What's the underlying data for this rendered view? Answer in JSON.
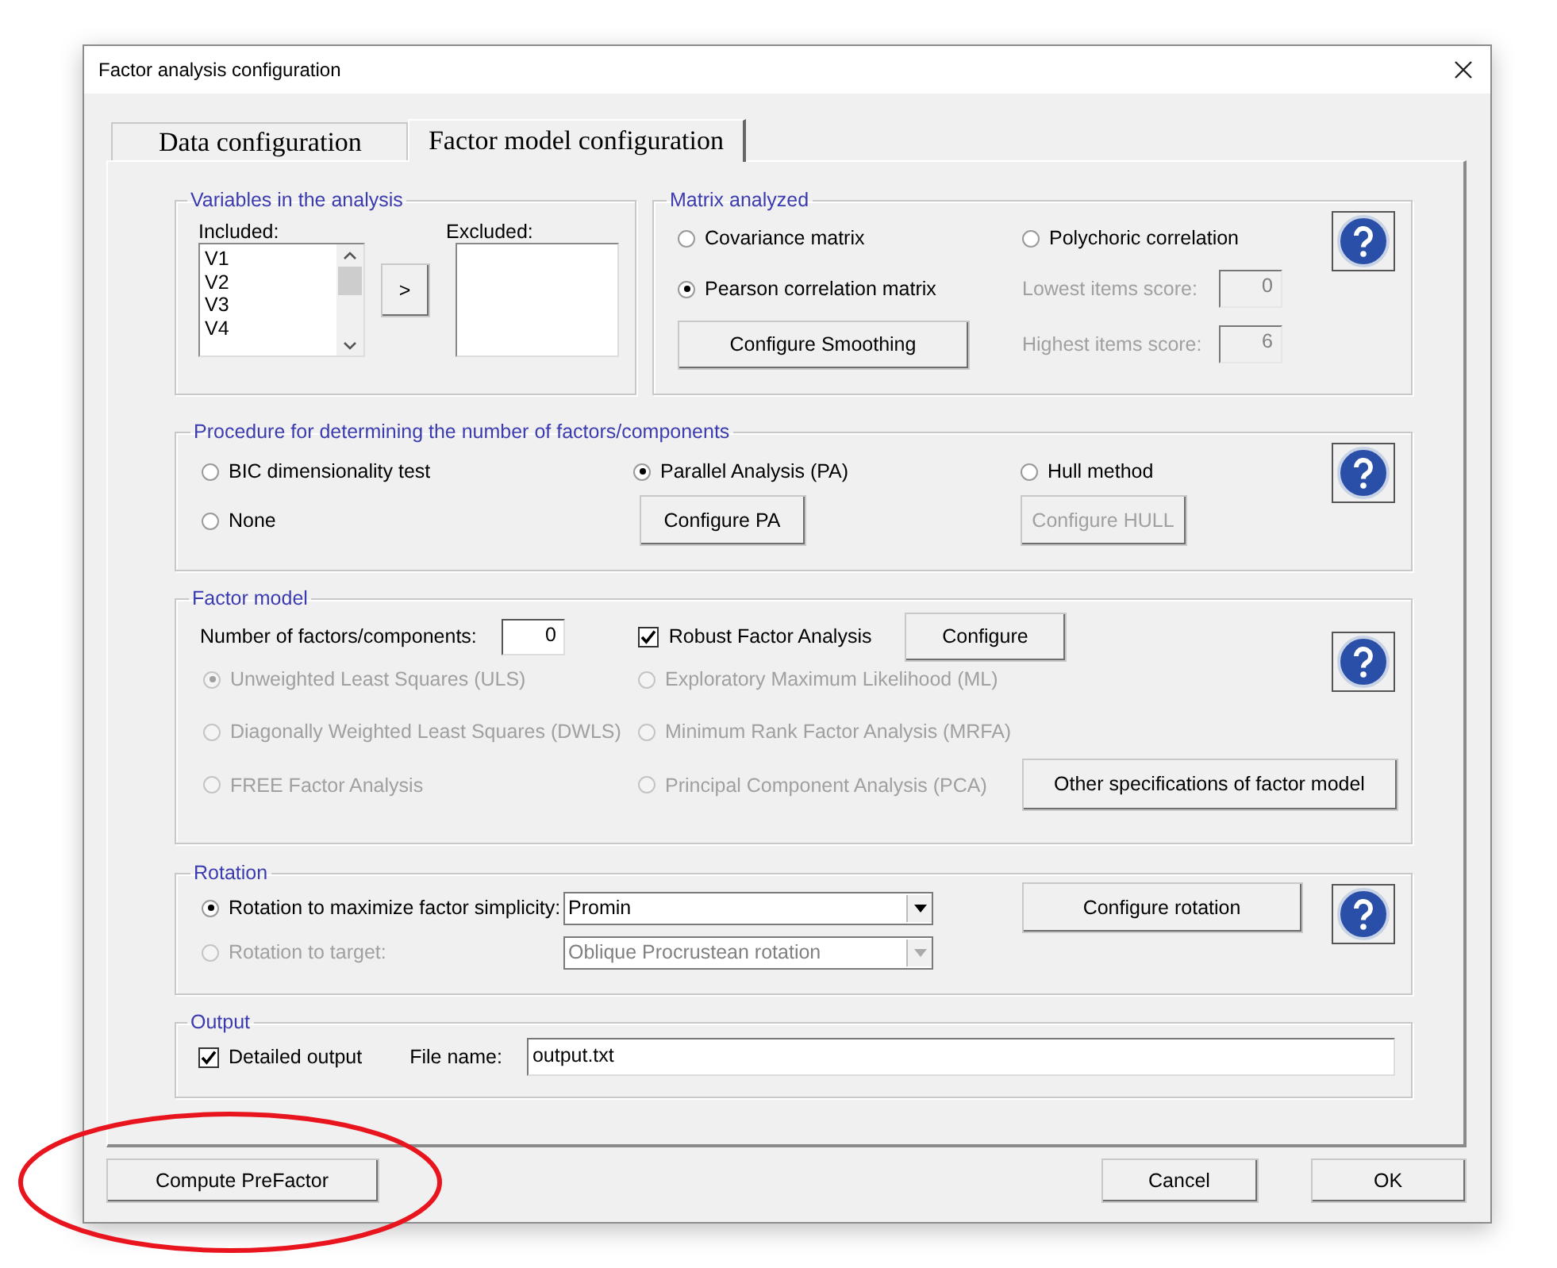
{
  "window": {
    "title": "Factor analysis configuration"
  },
  "tabs": [
    {
      "label": "Data configuration",
      "selected": false
    },
    {
      "label": "Factor model configuration",
      "selected": true
    }
  ],
  "variables": {
    "title": "Variables in the analysis",
    "included_label": "Included:",
    "included": [
      "V1",
      "V2",
      "V3",
      "V4"
    ],
    "move_button": ">",
    "excluded_label": "Excluded:"
  },
  "matrix": {
    "title": "Matrix analyzed",
    "options": [
      {
        "label": "Covariance matrix",
        "selected": false,
        "disabled": false
      },
      {
        "label": "Pearson correlation matrix",
        "selected": true,
        "disabled": false
      },
      {
        "label": "Polychoric correlation",
        "selected": false,
        "disabled": false
      }
    ],
    "smoothing_button": "Configure Smoothing",
    "scores": [
      {
        "label": "Lowest items score:",
        "value": "0",
        "disabled": true
      },
      {
        "label": "Highest items score:",
        "value": "6",
        "disabled": true
      }
    ]
  },
  "procedure": {
    "title": "Procedure for determining the number of factors/components",
    "options": [
      {
        "label": "BIC dimensionality test",
        "selected": false,
        "disabled": false
      },
      {
        "label": "Parallel Analysis (PA)",
        "selected": true,
        "disabled": false
      },
      {
        "label": "Hull method",
        "selected": false,
        "disabled": false
      },
      {
        "label": "None",
        "selected": false,
        "disabled": false
      }
    ],
    "buttons": [
      {
        "label": "Configure PA",
        "disabled": false
      },
      {
        "label": "Configure HULL",
        "disabled": true
      }
    ]
  },
  "factor_model": {
    "title": "Factor model",
    "factors_label": "Number of factors/components:",
    "factors_value": "0",
    "robust": {
      "label": "Robust Factor Analysis",
      "checked": true
    },
    "configure_button": "Configure",
    "methods": [
      {
        "label": "Unweighted Least Squares (ULS)",
        "selected": true,
        "disabled": true
      },
      {
        "label": "Exploratory Maximum Likelihood (ML)",
        "selected": false,
        "disabled": true
      },
      {
        "label": "Diagonally Weighted Least Squares (DWLS)",
        "selected": false,
        "disabled": true
      },
      {
        "label": "Minimum Rank Factor Analysis (MRFA)",
        "selected": false,
        "disabled": true
      },
      {
        "label": "FREE Factor Analysis",
        "selected": false,
        "disabled": true
      },
      {
        "label": "Principal Component Analysis (PCA)",
        "selected": false,
        "disabled": true
      }
    ],
    "other_button": "Other specifications of factor model"
  },
  "rotation": {
    "title": "Rotation",
    "options": [
      {
        "label": "Rotation to maximize factor simplicity:",
        "selected": true,
        "disabled": false,
        "choice": "Promin"
      },
      {
        "label": "Rotation to target:",
        "selected": false,
        "disabled": true,
        "choice": "Oblique Procrustean rotation"
      }
    ],
    "configure_button": "Configure rotation"
  },
  "output": {
    "title": "Output",
    "detailed": {
      "label": "Detailed output",
      "checked": true
    },
    "file_label": "File name:",
    "file_value": "output.txt"
  },
  "buttons": {
    "compute": "Compute PreFactor",
    "cancel": "Cancel",
    "ok": "OK"
  }
}
